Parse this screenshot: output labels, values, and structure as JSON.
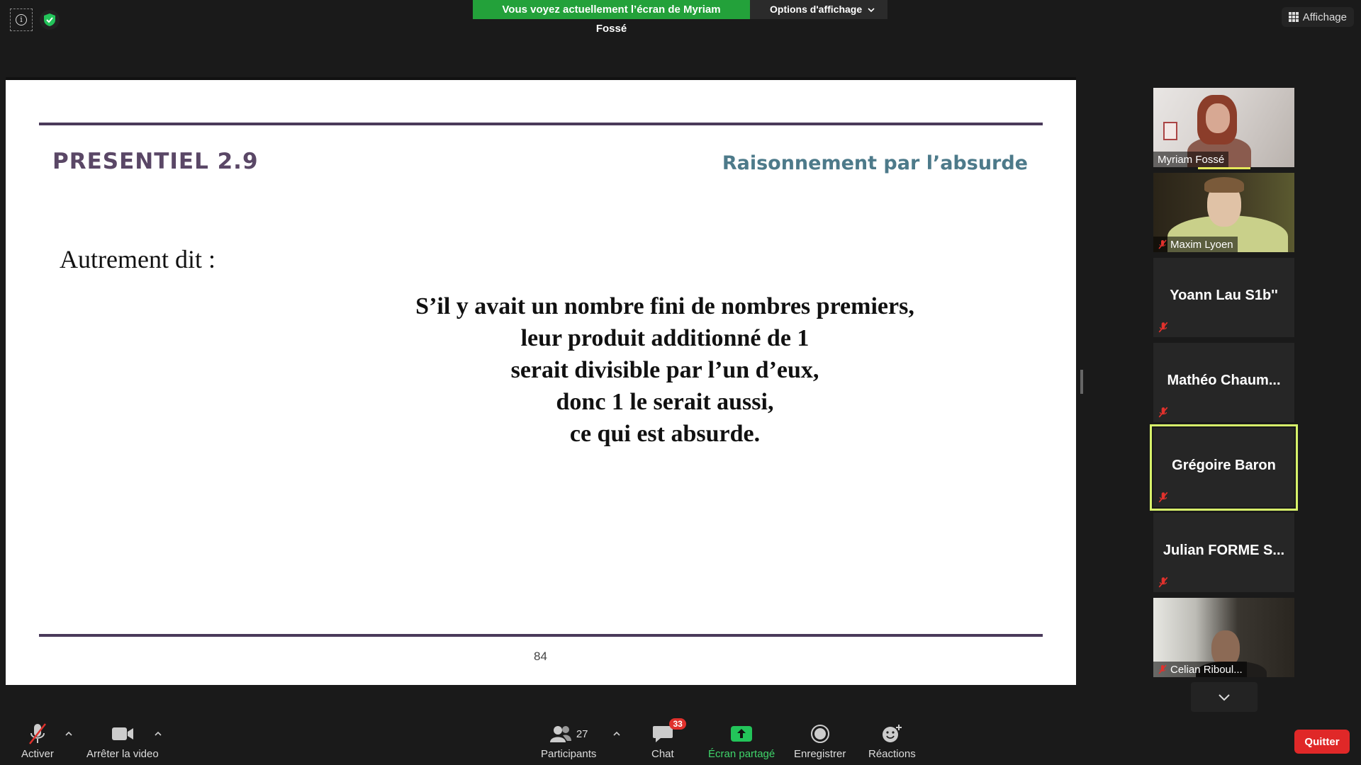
{
  "banner": {
    "share_message": "Vous voyez actuellement l’écran de Myriam Fossé",
    "view_options_label": "Options d'affichage"
  },
  "view_button": {
    "label": "Affichage"
  },
  "slide": {
    "heading": "PRESENTIEL 2.9",
    "topic": "Raisonnement par l’absurde",
    "subheading": "Autrement dit :",
    "body_lines": [
      "S’il y avait un nombre fini de nombres premiers,",
      "leur produit additionné de 1",
      "serait divisible par l’un d’eux,",
      "donc 1 le serait aussi,",
      "ce qui est absurde."
    ],
    "page_number": "84"
  },
  "participants_panel": {
    "tiles": [
      {
        "name": "Myriam Fossé",
        "type": "video",
        "muted": false
      },
      {
        "name": "Maxim Lyoen",
        "type": "video",
        "muted": true
      },
      {
        "name": "Yoann Lau S1b''",
        "type": "name",
        "muted": true
      },
      {
        "name": "Mathéo  Chaum...",
        "type": "name",
        "muted": true
      },
      {
        "name": "Grégoire Baron",
        "type": "name",
        "muted": true,
        "active": true
      },
      {
        "name": "Julian  FORME  S...",
        "type": "name",
        "muted": true
      },
      {
        "name": "Celian Riboul...",
        "type": "video",
        "muted": true
      }
    ]
  },
  "toolbar": {
    "mute_label": "Activer",
    "video_label": "Arrêter la video",
    "participants_label": "Participants",
    "participants_count": "27",
    "chat_label": "Chat",
    "chat_badge": "33",
    "share_label": "Écran partagé",
    "record_label": "Enregistrer",
    "reactions_label": "Réactions",
    "quit_label": "Quitter"
  },
  "colors": {
    "share_green": "#23a13a",
    "slide_heading": "#5a4766",
    "slide_topic": "#4d7a8a",
    "active_speaker": "#d7f26a",
    "quit_red": "#e02828"
  }
}
